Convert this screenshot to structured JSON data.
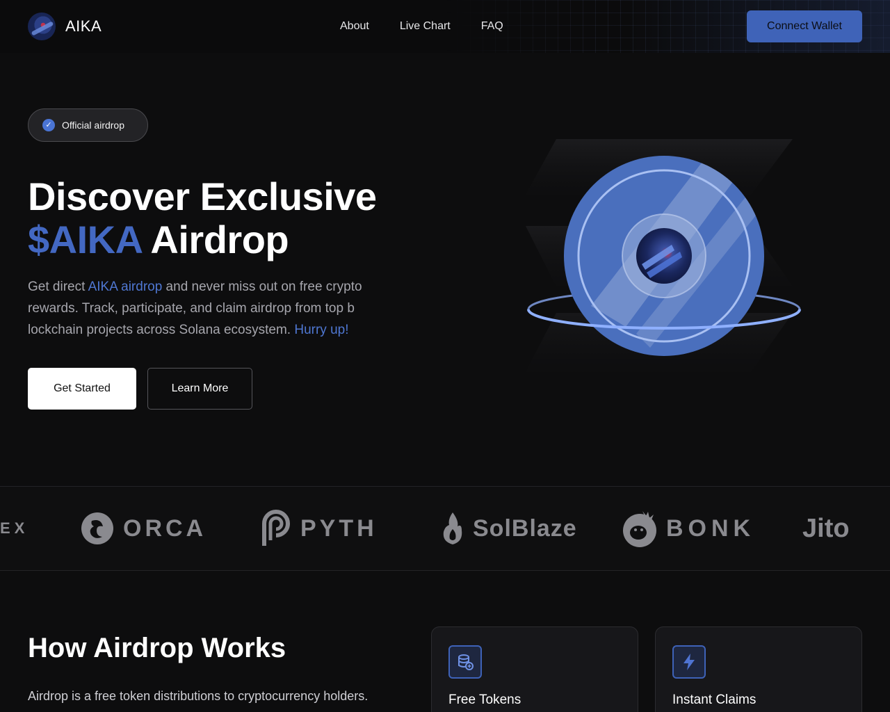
{
  "header": {
    "logo_text": "AIKA",
    "nav": [
      {
        "label": "About"
      },
      {
        "label": "Live Chart"
      },
      {
        "label": "FAQ"
      }
    ],
    "connect_label": "Connect Wallet"
  },
  "hero": {
    "badge": "Official airdrop",
    "title_line1": "Discover Exclusive",
    "title_accent": "$AIKA",
    "title_rest": " Airdrop",
    "desc_part1": " Get direct ",
    "desc_link": "AIKA airdrop",
    "desc_part2": " and never miss out on free crypto rewards. Track, participate, and claim airdrop from top b lockchain projects across Solana ecosystem. ",
    "desc_accent": "Hurry up!",
    "primary_label": "Get Started",
    "secondary_label": "Learn More"
  },
  "partners": [
    {
      "name": "EX",
      "icon": "partial-logo"
    },
    {
      "name": "ORCA",
      "icon": "orca-icon"
    },
    {
      "name": "PYTH",
      "icon": "pyth-icon"
    },
    {
      "name": "SolBlaze",
      "icon": "flame-icon"
    },
    {
      "name": "BONK",
      "icon": "bonk-dog-icon"
    },
    {
      "name": "Jito",
      "icon": "jito-wordmark"
    }
  ],
  "how": {
    "title": "How Airdrop Works",
    "desc": "Airdrop is a free token distributions to cryptocurrency holders.",
    "cards": [
      {
        "title": "Free Tokens",
        "icon": "coin-stack-icon"
      },
      {
        "title": "Instant Claims",
        "icon": "lightning-icon"
      }
    ]
  },
  "colors": {
    "accent": "#4368c2",
    "button": "#3f63b8",
    "background": "#0d0d0e"
  }
}
